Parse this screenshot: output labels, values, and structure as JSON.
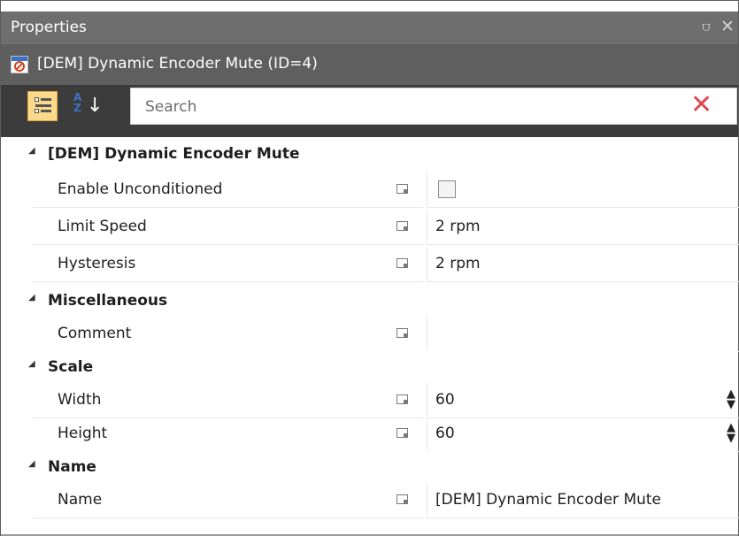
{
  "window": {
    "title": "Properties",
    "pin_glyph": "⩌",
    "close_glyph": "✕"
  },
  "object": {
    "icon": "dynamic-encoder-mute-icon",
    "title": "[DEM] Dynamic Encoder Mute (ID=4)"
  },
  "toolbar": {
    "categorized_icon": "categorized-view-icon",
    "alphabetical_icon": "sort-alphabetical-icon",
    "az_text": "A Z",
    "arrow_glyph": "↓",
    "search_placeholder": "Search",
    "search_value": "",
    "clear_glyph": "✕",
    "clear_color": "#e0464e"
  },
  "categories": [
    {
      "name": "[DEM] Dynamic Encoder Mute",
      "properties": [
        {
          "name": "Enable Unconditioned",
          "type": "checkbox",
          "checked": false,
          "value": ""
        },
        {
          "name": "Limit Speed",
          "type": "text",
          "value": "2 rpm"
        },
        {
          "name": "Hysteresis",
          "type": "text",
          "value": "2 rpm"
        }
      ]
    },
    {
      "name": "Miscellaneous",
      "properties": [
        {
          "name": "Comment",
          "type": "text",
          "value": ""
        }
      ]
    },
    {
      "name": "Scale",
      "properties": [
        {
          "name": "Width",
          "type": "spinner",
          "value": "60"
        },
        {
          "name": "Height",
          "type": "spinner",
          "value": "60"
        }
      ]
    },
    {
      "name": "Name",
      "properties": [
        {
          "name": "Name",
          "type": "text",
          "value": "[DEM] Dynamic Encoder Mute"
        }
      ]
    }
  ],
  "colors": {
    "title_bar": "#6e6e6e",
    "object_bar": "#5f5f5f",
    "toolbar": "#3c3c3c",
    "accent_selected": "#fbd98a"
  }
}
